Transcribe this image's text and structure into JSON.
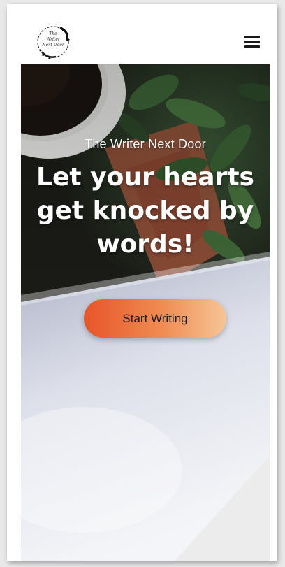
{
  "header": {
    "logo": {
      "text": "The\nWriter\nNext Door",
      "icon": "floral-wreath-logo"
    },
    "menu_icon": "hamburger-menu-icon"
  },
  "hero": {
    "subtitle": "The Writer Next Door",
    "headline": "Let your hearts get knocked by words!",
    "cta_label": "Start Writing",
    "background": "coffee-cup-plant-paper-photo"
  },
  "colors": {
    "cta_gradient_start": "#e8542a",
    "cta_gradient_end": "#f6c596",
    "hero_text": "#ffffff"
  }
}
